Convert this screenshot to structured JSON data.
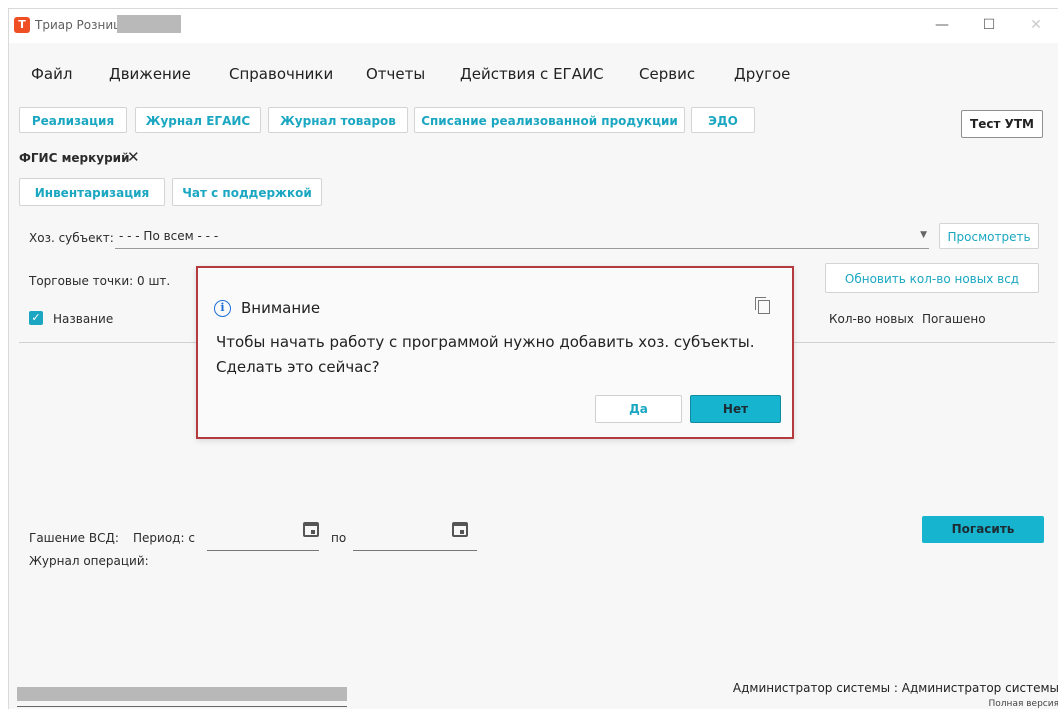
{
  "window": {
    "title": "Триар Розница",
    "minimize": "—",
    "maximize": "☐",
    "close": "✕"
  },
  "menu": [
    "Файл",
    "Движение",
    "Справочники",
    "Отчеты",
    "Действия с ЕГАИС",
    "Сервис",
    "Другое"
  ],
  "toolbar": {
    "buttons": [
      "Реализация",
      "Журнал ЕГАИС",
      "Журнал товаров",
      "Списание реализованной продукции",
      "ЭДО"
    ],
    "test_utm": "Тест УТМ"
  },
  "tab": {
    "label": "ФГИС меркурий",
    "close": "✕"
  },
  "subtabs": [
    "Инвентаризация",
    "Чат с поддержкой"
  ],
  "subject": {
    "label": "Хоз. субъект:",
    "value": "- - - По всем - - -",
    "view_button": "Просмотреть"
  },
  "points": {
    "label": "Торговые точки: 0 шт.",
    "update_button": "Обновить кол-во новых всд"
  },
  "table": {
    "checkbox": "✓",
    "col_name": "Название",
    "col_new": "Кол-во новых",
    "col_paid": "Погашено"
  },
  "vsd": {
    "label": "Гашение ВСД:",
    "period_label": "Период: с",
    "to_label": "по",
    "button": "Погасить"
  },
  "journal_label": "Журнал операций:",
  "footer": {
    "user": "Администратор системы : Администратор системы",
    "version": "Полная версия"
  },
  "dialog": {
    "title": "Внимание",
    "info_glyph": "i",
    "message": "Чтобы начать работу с программой нужно добавить хоз. субъекты. Сделать это сейчас?",
    "yes": "Да",
    "no": "Нет"
  },
  "colors": {
    "accent": "#16b4cf",
    "link_text": "#1ba7c1",
    "dialog_border": "#b43a3d",
    "app_icon": "#f04e23"
  }
}
